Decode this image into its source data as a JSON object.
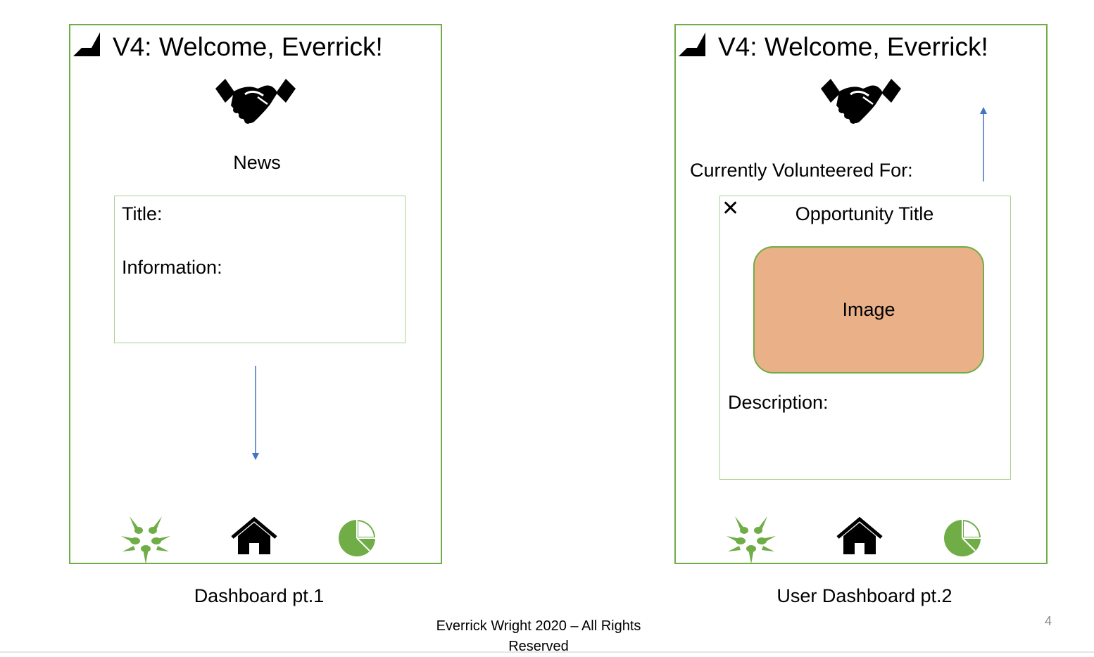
{
  "left_screen": {
    "title": "V4: Welcome, Everrick!",
    "section_heading": "News",
    "card": {
      "title_label": "Title:",
      "information_label": "Information:"
    },
    "nav_icons": [
      "volunteer-hands-icon",
      "home-icon",
      "pie-chart-icon"
    ],
    "caption": "Dashboard pt.1"
  },
  "right_screen": {
    "title": "V4: Welcome, Everrick!",
    "section_heading": "Currently Volunteered For:",
    "card": {
      "close_symbol": "✕",
      "title": "Opportunity Title",
      "image_label": "Image",
      "description_label": "Description:"
    },
    "nav_icons": [
      "volunteer-hands-icon",
      "home-icon",
      "pie-chart-icon"
    ],
    "caption": "User Dashboard pt.2"
  },
  "footer": {
    "line1": "Everrick Wright 2020 – All Rights",
    "line2": "Reserved"
  },
  "page_number": "4",
  "colors": {
    "frame_border": "#70ad47",
    "card_border": "#a9d08e",
    "image_fill": "#eab088",
    "arrow": "#4472c4",
    "icon_green": "#70ad47"
  }
}
